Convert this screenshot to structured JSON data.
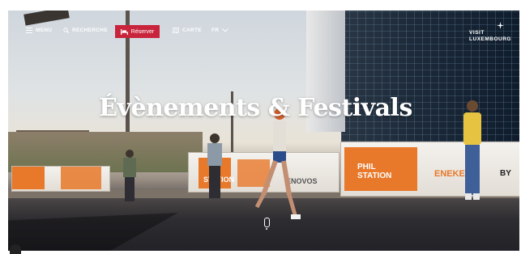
{
  "nav": {
    "menu_label": "MENU",
    "search_label": "RECHERCHE",
    "reserve_label": "Réserver",
    "map_label": "CARTE",
    "language_label": "FR"
  },
  "logo": {
    "line1": "VISIT",
    "line2": "LUXEMBOURG"
  },
  "hero": {
    "title": "Évènements & Festivals"
  },
  "banners": {
    "station_line1": "PHIL",
    "station_line2": "STATION",
    "enovos": "ENOVOS",
    "energy": "ENEKE",
    "by": "BY"
  },
  "colors": {
    "reserve_button": "#c8253d",
    "banner_orange": "#e8782a"
  },
  "icons": [
    "menu-icon",
    "search-icon",
    "bed-icon",
    "map-icon",
    "chevron-down-icon",
    "luxembourg-star-icon",
    "scroll-mouse-icon"
  ]
}
